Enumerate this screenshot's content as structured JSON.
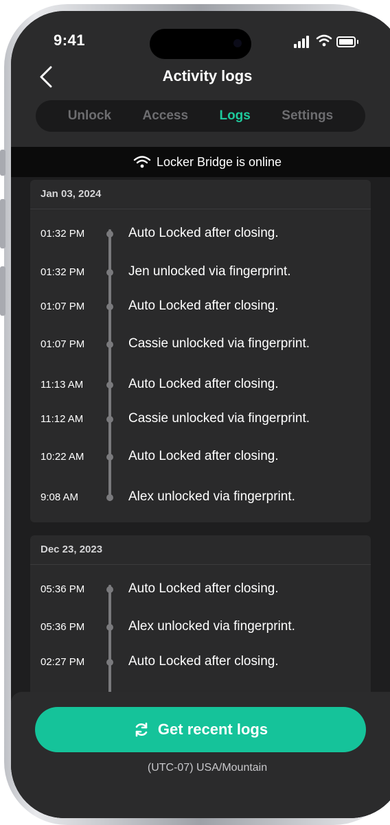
{
  "status_bar": {
    "time": "9:41"
  },
  "header": {
    "title": "Activity logs",
    "back_icon": "chevron-left-icon"
  },
  "tabs": [
    {
      "label": "Unlock",
      "active": false
    },
    {
      "label": "Access",
      "active": false
    },
    {
      "label": "Logs",
      "active": true
    },
    {
      "label": "Settings",
      "active": false
    }
  ],
  "bridge_banner": {
    "icon": "wifi-icon",
    "text": "Locker Bridge is online"
  },
  "log_groups": [
    {
      "date": "Jan 03, 2024",
      "entries": [
        {
          "time": "01:32 PM",
          "text": "Auto Locked after closing."
        },
        {
          "time": "01:32 PM",
          "text": "Jen unlocked via fingerprint."
        },
        {
          "time": "01:07 PM",
          "text": "Auto Locked after closing."
        },
        {
          "time": "01:07 PM",
          "text": "Cassie unlocked via fingerprint."
        },
        {
          "time": "11:13 AM",
          "text": "Auto Locked after closing."
        },
        {
          "time": "11:12 AM",
          "text": "Cassie unlocked via fingerprint."
        },
        {
          "time": "10:22 AM",
          "text": "Auto Locked after closing."
        },
        {
          "time": "9:08 AM",
          "text": "Alex unlocked via fingerprint."
        }
      ]
    },
    {
      "date": "Dec 23, 2023",
      "entries": [
        {
          "time": "05:36 PM",
          "text": "Auto Locked after closing."
        },
        {
          "time": "05:36 PM",
          "text": "Alex unlocked via fingerprint."
        },
        {
          "time": "02:27 PM",
          "text": "Auto Locked after closing."
        }
      ]
    }
  ],
  "refresh_button": {
    "label": "Get recent logs",
    "icon": "refresh-icon"
  },
  "timezone": "(UTC-07) USA/Mountain",
  "colors": {
    "accent": "#1ec99c",
    "button": "#15c39a",
    "background": "#1e1e1f",
    "card": "#2a2a2b"
  }
}
